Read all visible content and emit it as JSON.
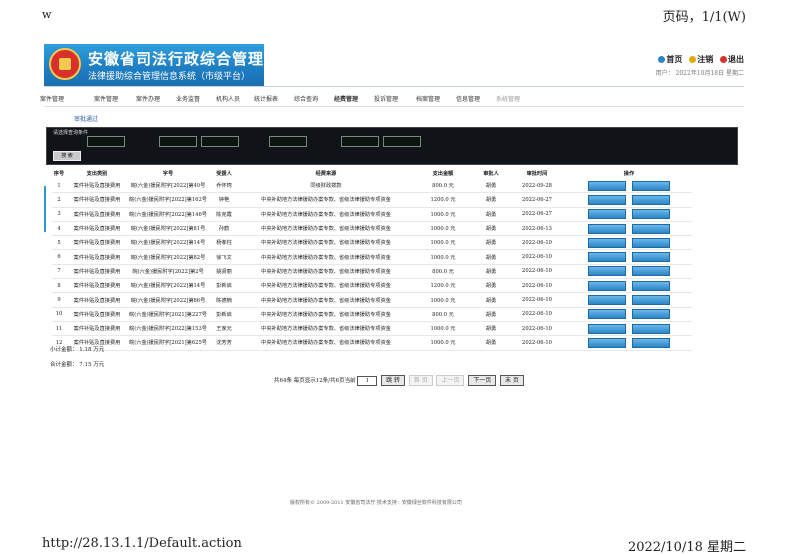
{
  "print": {
    "left_mark": "w",
    "page_number": "页码，1/1(W)",
    "url": "http://28.13.1.1/Default.action",
    "date": "2022/10/18 星期二"
  },
  "header": {
    "title": "安徽省司法行政综合管理平台",
    "subtitle": "法律援助综合管理信息系统（市级平台）",
    "actions": [
      "首页",
      "注销",
      "退出"
    ],
    "user_info": "用户：  2022年10月18日  星期二"
  },
  "nav": {
    "items": [
      "案件管理",
      "案件管理",
      "案件办理",
      "业务监督",
      "机构人员",
      "统计报表",
      "综合查询",
      "经费管理",
      "投诉管理",
      "档案管理",
      "信息管理",
      "系统管理"
    ]
  },
  "subtab": "审批通过",
  "criteria": {
    "label": "请选择查询条件",
    "search_label": "搜 索"
  },
  "table": {
    "headers": [
      "序号",
      "支出类别",
      "字号",
      "受援人",
      "经费来源",
      "支出金额",
      "审批人",
      "审批时间",
      "操作"
    ],
    "rows": [
      {
        "n": "1",
        "category": "案件补贴及直接费用",
        "case_no": "皖(六金)援民附字[2022]第40号",
        "person": "乔怀珂",
        "source": "同级财政拨款",
        "amount": "800.0 元",
        "approver": "胡勇",
        "date": "2022-09-28"
      },
      {
        "n": "2",
        "category": "案件补贴及直接费用",
        "case_no": "皖(六金)援民附字[2022]第162号",
        "person": "钟艳",
        "source": "中央补助地方法律援助办案专款、省级法律援助专项资金",
        "amount": "1200.0 元",
        "approver": "胡勇",
        "date": "2022-06-27"
      },
      {
        "n": "3",
        "category": "案件补贴及直接费用",
        "case_no": "皖(六金)援民附字[2022]第146号",
        "person": "陈克霞",
        "source": "中央补助地方法律援助办案专款、省级法律援助专项资金",
        "amount": "1000.0 元",
        "approver": "胡勇",
        "date": "2022-06-27"
      },
      {
        "n": "4",
        "category": "案件补贴及直接费用",
        "case_no": "皖(六金)援民附字[2022]第81号",
        "person": "孙鹤",
        "source": "中央补助地方法律援助办案专款、省级法律援助专项资金",
        "amount": "1000.0 元",
        "approver": "胡勇",
        "date": "2022-06-13"
      },
      {
        "n": "5",
        "category": "案件补贴及直接费用",
        "case_no": "皖(六金)援民附字[2022]第14号",
        "person": "杨孝柱",
        "source": "中央补助地方法律援助办案专款、省级法律援助专项资金",
        "amount": "1000.0 元",
        "approver": "胡勇",
        "date": "2022-06-10"
      },
      {
        "n": "6",
        "category": "案件补贴及直接费用",
        "case_no": "皖(六金)援民附字[2022]第82号",
        "person": "徐飞文",
        "source": "中央补助地方法律援助办案专款、省级法律援助专项资金",
        "amount": "1000.0 元",
        "approver": "胡勇",
        "date": "2022-06-10"
      },
      {
        "n": "7",
        "category": "案件补贴及直接费用",
        "case_no": "皖(六金)援民附字[2022]第2号",
        "person": "姚贤丽",
        "source": "中央补助地方法律援助办案专款、省级法律援助专项资金",
        "amount": "800.0 元",
        "approver": "胡勇",
        "date": "2022-06-10"
      },
      {
        "n": "8",
        "category": "案件补贴及直接费用",
        "case_no": "皖(六金)援民附字[2022]第14号",
        "person": "彭新启",
        "source": "中央补助地方法律援助办案专款、省级法律援助专项资金",
        "amount": "1200.0 元",
        "approver": "胡勇",
        "date": "2022-06-10"
      },
      {
        "n": "9",
        "category": "案件补贴及直接费用",
        "case_no": "皖(六金)援民附字[2022]第86号",
        "person": "陈德楠",
        "source": "中央补助地方法律援助办案专款、省级法律援助专项资金",
        "amount": "1000.0 元",
        "approver": "胡勇",
        "date": "2022-06-10"
      },
      {
        "n": "10",
        "category": "案件补贴及直接费用",
        "case_no": "皖(六金)援民附字[2021]第227号",
        "person": "彭新启",
        "source": "中央补助地方法律援助办案专款、省级法律援助专项资金",
        "amount": "800.0 元",
        "approver": "胡勇",
        "date": "2022-06-10"
      },
      {
        "n": "11",
        "category": "案件补贴及直接费用",
        "case_no": "皖(六金)援民附字[2022]第153号",
        "person": "王家元",
        "source": "中央补助地方法律援助办案专款、省级法律援助专项资金",
        "amount": "1000.0 元",
        "approver": "胡勇",
        "date": "2022-06-10"
      },
      {
        "n": "12",
        "category": "案件补贴及直接费用",
        "case_no": "皖(六金)援民附字[2021]第625号",
        "person": "沈芳芳",
        "source": "中央补助地方法律援助办案专款、省级法律援助专项资金",
        "amount": "1000.0 元",
        "approver": "胡勇",
        "date": "2022-06-10"
      }
    ]
  },
  "totals": {
    "subtotal": "小计金额：  1.18  万元",
    "total": "合计金额：  7.15  万元"
  },
  "pager": {
    "summary": "共64条  每页显示12条/共6页当前",
    "current": "1",
    "jump": "跳 转",
    "first": "首 页",
    "prev": "上一页",
    "next": "下一页",
    "last": "末 页"
  },
  "footer": "版权所有© 2009-2011 安徽省司法厅    技术支持：安徽绿丝软件科技有限公司",
  "colors": {
    "banner": "#1f7fc4",
    "button": "#2b86c8",
    "criteria_bg": "#101418"
  }
}
